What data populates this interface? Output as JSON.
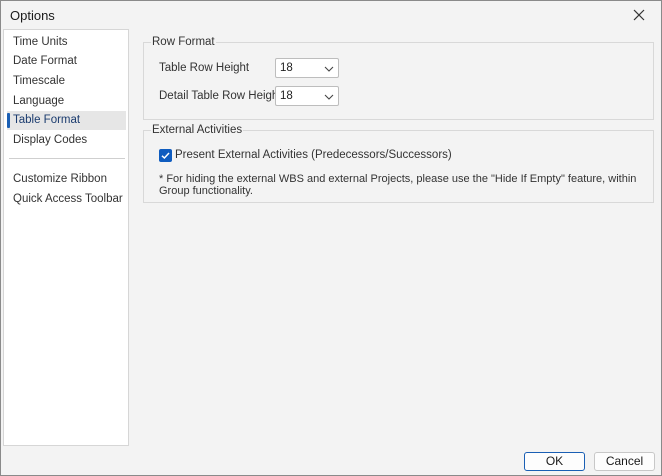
{
  "window": {
    "title": "Options"
  },
  "sidebar": {
    "items": [
      {
        "label": "Time Units"
      },
      {
        "label": "Date Format"
      },
      {
        "label": "Timescale"
      },
      {
        "label": "Language"
      },
      {
        "label": "Table Format",
        "selected": true
      },
      {
        "label": "Display Codes"
      },
      {
        "label": "Customize Ribbon"
      },
      {
        "label": "Quick Access Toolbar"
      }
    ]
  },
  "row_format": {
    "group_label": "Row Format",
    "table_row_height_label": "Table Row Height",
    "table_row_height_value": "18",
    "detail_row_height_label": "Detail Table Row Height",
    "detail_row_height_value": "18"
  },
  "external_activities": {
    "group_label": "External Activities",
    "checkbox_label": "Present External Activities (Predecessors/Successors)",
    "checked": true,
    "note": "* For hiding the external WBS and external Projects, please use the \"Hide If Empty\" feature, within Group functionality."
  },
  "footer": {
    "ok_label": "OK",
    "cancel_label": "Cancel"
  },
  "colors": {
    "accent": "#0f5cbf",
    "selected_bg": "#e6e6e6"
  }
}
